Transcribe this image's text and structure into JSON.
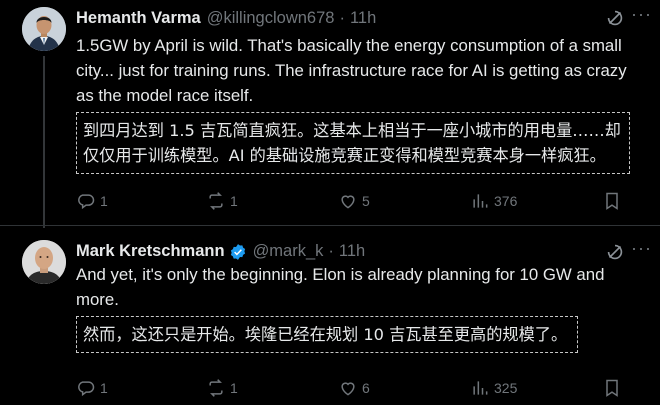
{
  "reply1": {
    "name": "Hemanth Varma",
    "handle": "@killingclown678",
    "dot": "·",
    "time": "11h",
    "text": "1.5GW by April is wild. That's basically the energy consumption of a small city... just for training runs. The infrastructure race for AI is getting as crazy as the model race itself.",
    "translation": "到四月达到 1.5 吉瓦简直疯狂。这基本上相当于一座小城市的用电量……却仅仅用于训练模型。AI 的基础设施竞赛正变得和模型竞赛本身一样疯狂。",
    "stats": {
      "replies": "1",
      "reposts": "1",
      "likes": "5",
      "views": "376"
    }
  },
  "reply2": {
    "name": "Mark Kretschmann",
    "handle": "@mark_k",
    "dot": "·",
    "time": "11h",
    "text": "And yet, it's only the beginning. Elon is already planning for 10 GW and more.",
    "translation": "然而，这还只是开始。埃隆已经在规划 10 吉瓦甚至更高的规模了。",
    "stats": {
      "replies": "1",
      "reposts": "1",
      "likes": "6",
      "views": "325"
    }
  },
  "ui": {
    "more_glyph": "···"
  },
  "colors": {
    "background": "#000000",
    "text": "#e7e9ea",
    "muted": "#71767b",
    "verified": "#1d9bf0",
    "divider": "#2f3336"
  },
  "icons": [
    "grok-icon",
    "more-icon",
    "reply-icon",
    "repost-icon",
    "like-icon",
    "views-icon",
    "bookmark-icon",
    "verified-badge-icon"
  ]
}
